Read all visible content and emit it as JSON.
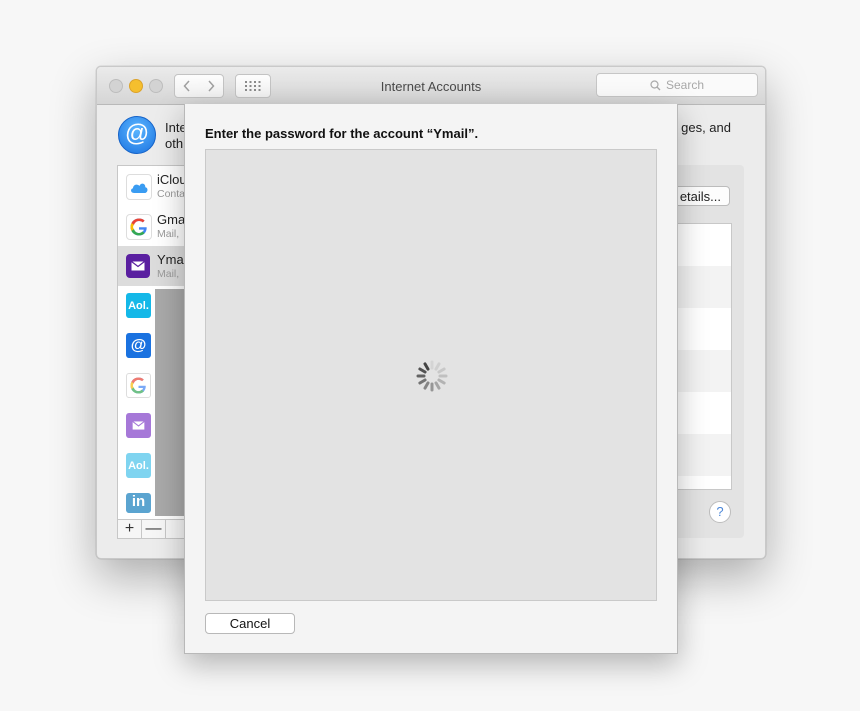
{
  "window": {
    "title": "Internet Accounts",
    "search_placeholder": "Search",
    "header_line1": "Inte",
    "header_line2": "oth",
    "header_line1_end": "ges, and",
    "details_label": "etails...",
    "help_label": "?"
  },
  "accounts": [
    {
      "name": "iClou",
      "sub": "Conta"
    },
    {
      "name": "Gmai",
      "sub": "Mail, "
    },
    {
      "name": "Ymai",
      "sub": "Mail, "
    }
  ],
  "providers": {
    "aol_label": "Aol.",
    "at_label": "@",
    "google_label": "G",
    "linkedin_label": "in"
  },
  "list_tools": {
    "add": "+",
    "remove": "—"
  },
  "sheet": {
    "title": "Enter the password for the account “Ymail”.",
    "cancel_label": "Cancel"
  },
  "colors": {
    "traffic_min": "#f5bf2e",
    "accent_blue": "#1a72e0",
    "yahoo_purple": "#5a1fa0",
    "aol_blue": "#14b8e8",
    "linkedin_blue": "#0a78b5"
  }
}
